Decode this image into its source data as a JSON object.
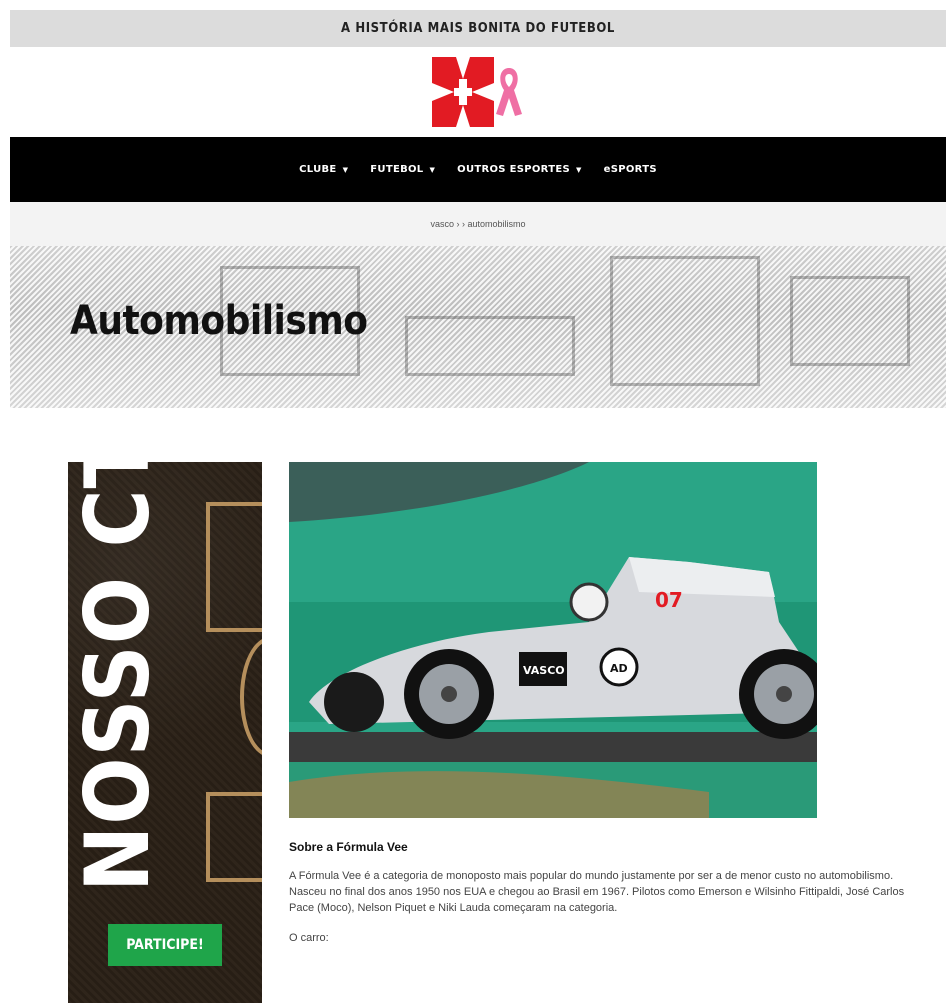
{
  "topbar": {
    "tagline": "A HISTÓRIA MAIS BONITA DO FUTEBOL"
  },
  "logo": {
    "icon": "vasco-cross-icon",
    "ribbon": "pink-ribbon-icon",
    "colors": {
      "cross": "#e21b23",
      "ribbon": "#ef6fa4"
    }
  },
  "nav": {
    "items": [
      {
        "label": "CLUBE",
        "has_dropdown": true
      },
      {
        "label": "FUTEBOL",
        "has_dropdown": true
      },
      {
        "label": "OUTROS ESPORTES",
        "has_dropdown": true
      },
      {
        "label": "eSPORTS",
        "has_dropdown": false
      }
    ]
  },
  "breadcrumb": {
    "text": "vasco › › automobilismo"
  },
  "hero": {
    "title": "Automobilismo"
  },
  "banner": {
    "headline": "NOSSO CT",
    "cta": "PARTICIPE!",
    "colors": {
      "cta": "#1fa54a"
    }
  },
  "photo": {
    "car_number": "07",
    "sponsor": "VASCO",
    "badge": "AD"
  },
  "article": {
    "heading": "Sobre a Fórmula Vee",
    "paragraph": "A Fórmula Vee é a categoria de monoposto mais popular do mundo justamente por ser a de menor custo no automobilismo. Nasceu no final dos anos 1950 nos EUA e chegou ao Brasil em 1967. Pilotos como Emerson e Wilsinho Fittipaldi, José Carlos Pace (Moco), Nelson Piquet e Niki Lauda começaram na categoria.",
    "subheading": "O carro:"
  }
}
